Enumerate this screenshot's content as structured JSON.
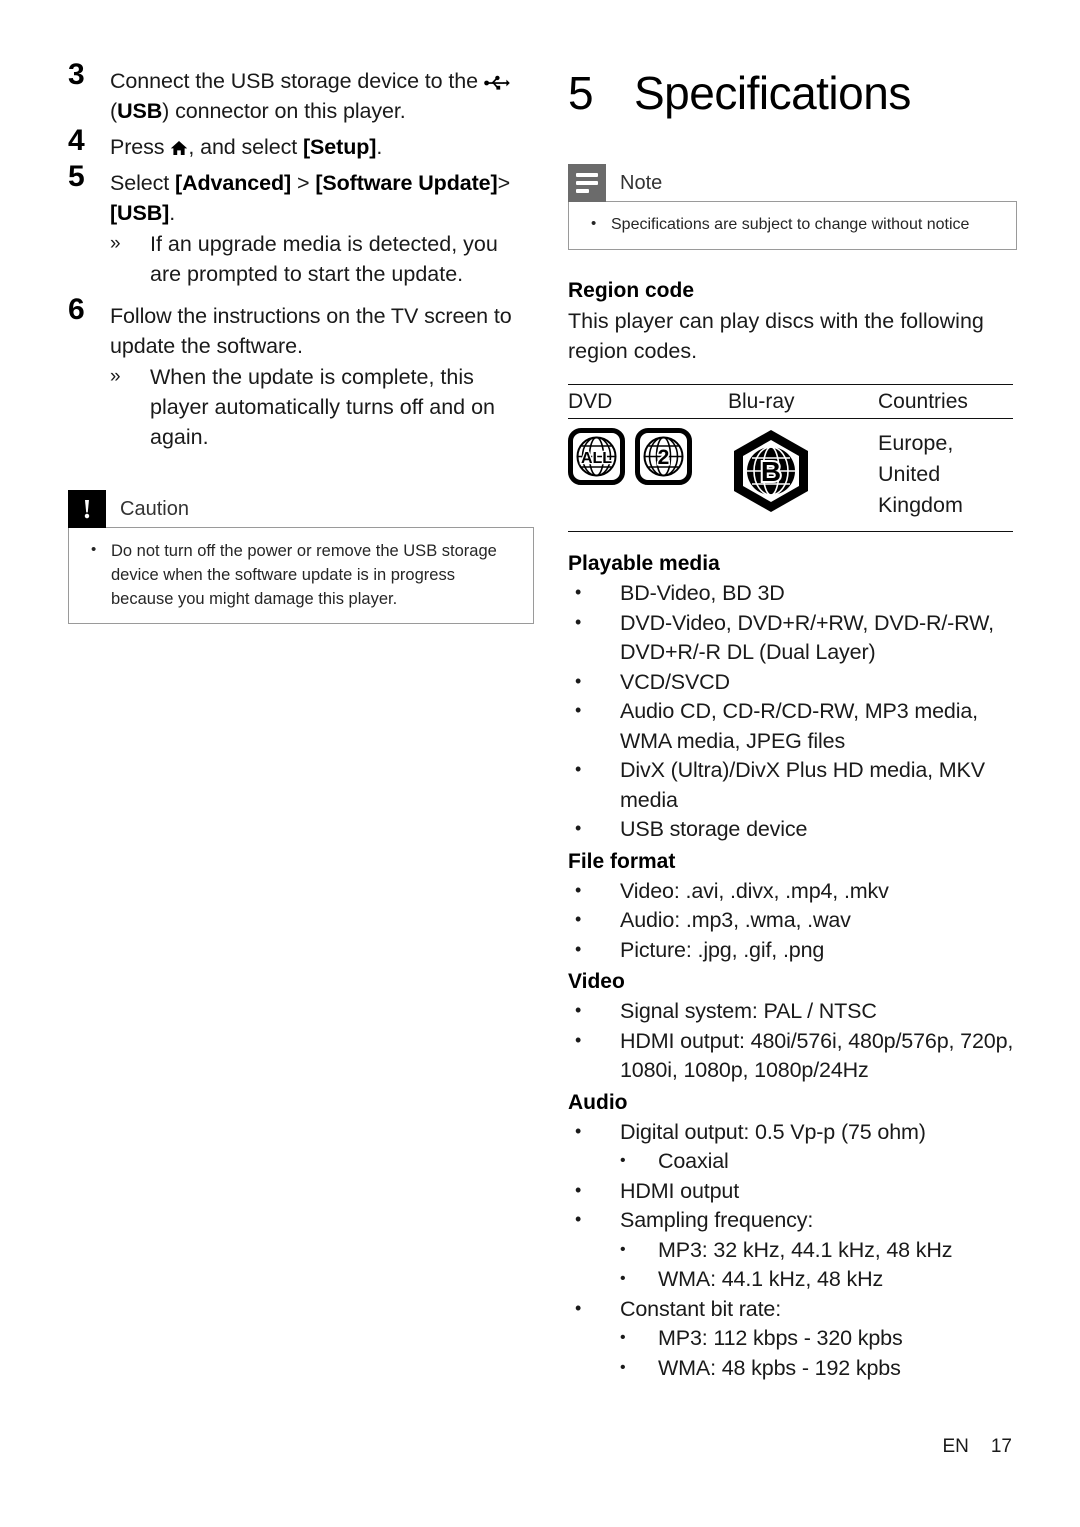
{
  "left_column": {
    "steps": [
      {
        "number": "3",
        "text_before_icon": "Connect the USB storage device to the",
        "icon": "usb-icon",
        "text_after_icon_plain_1": " (",
        "bold_usb": "USB",
        "text_after_icon_plain_2": ") connector on this player."
      },
      {
        "number": "4",
        "press_label": "Press ",
        "icon": "home-icon",
        "and_select": ", and select ",
        "bold_setup": "[Setup]",
        "period": "."
      },
      {
        "number": "5",
        "select_label": "Select ",
        "bold_advanced": "[Advanced]",
        "gt1": " > ",
        "bold_software_update": "[Software Update]",
        "gt2": ">",
        "bold_usb": "[USB]",
        "period": ".",
        "subitems": [
          "If an upgrade media is detected, you are prompted to start the update."
        ]
      },
      {
        "number": "6",
        "text": "Follow the instructions on the TV screen to update the software.",
        "subitems": [
          "When the update is complete, this player automatically turns off and on again."
        ]
      }
    ],
    "caution": {
      "badge_glyph": "!",
      "title": "Caution",
      "items": [
        "Do not turn off the power or remove the USB storage device when the software update is in progress because you might damage this player."
      ]
    }
  },
  "right_column": {
    "chapter": {
      "number": "5",
      "title": "Specifications"
    },
    "note": {
      "title": "Note",
      "items": [
        "Specifications are subject to change without notice"
      ]
    },
    "region_code": {
      "heading": "Region code",
      "paragraph": "This player can play discs with the following region codes.",
      "table": {
        "headers": [
          "DVD",
          "Blu-ray",
          "Countries"
        ],
        "dvd_logos": [
          "ALL",
          "2"
        ],
        "bluray_logo": "B",
        "countries": "Europe, United Kingdom"
      }
    },
    "playable_media": {
      "heading": "Playable media",
      "items": [
        "BD-Video, BD 3D",
        "DVD-Video, DVD+R/+RW, DVD-R/-RW, DVD+R/-R DL (Dual Layer)",
        "VCD/SVCD",
        "Audio CD, CD-R/CD-RW, MP3 media, WMA media, JPEG files",
        "DivX (Ultra)/DivX Plus HD media, MKV media",
        "USB storage device"
      ]
    },
    "file_format": {
      "heading": "File format",
      "items": [
        "Video: .avi, .divx, .mp4, .mkv",
        "Audio: .mp3, .wma, .wav",
        "Picture: .jpg, .gif, .png"
      ]
    },
    "video": {
      "heading": "Video",
      "items": [
        "Signal system: PAL / NTSC",
        "HDMI output: 480i/576i, 480p/576p, 720p, 1080i, 1080p, 1080p/24Hz"
      ]
    },
    "audio": {
      "heading": "Audio",
      "items": [
        {
          "level": 1,
          "text": "Digital output: 0.5 Vp-p (75 ohm)"
        },
        {
          "level": 2,
          "text": "Coaxial"
        },
        {
          "level": 1,
          "text": "HDMI output"
        },
        {
          "level": 1,
          "text": "Sampling frequency:"
        },
        {
          "level": 2,
          "text": "MP3: 32 kHz, 44.1 kHz, 48 kHz"
        },
        {
          "level": 2,
          "text": "WMA: 44.1 kHz, 48 kHz"
        },
        {
          "level": 1,
          "text": "Constant bit rate:"
        },
        {
          "level": 2,
          "text": "MP3: 112 kbps - 320 kpbs"
        },
        {
          "level": 2,
          "text": "WMA: 48 kpbs - 192 kpbs"
        }
      ]
    }
  },
  "footer": {
    "language": "EN",
    "page_number": "17"
  },
  "colors": {
    "text": "#1a1a1a",
    "caution_badge": "#000000",
    "note_badge": "#6b6b6b",
    "box_border": "#9a9a9a"
  }
}
